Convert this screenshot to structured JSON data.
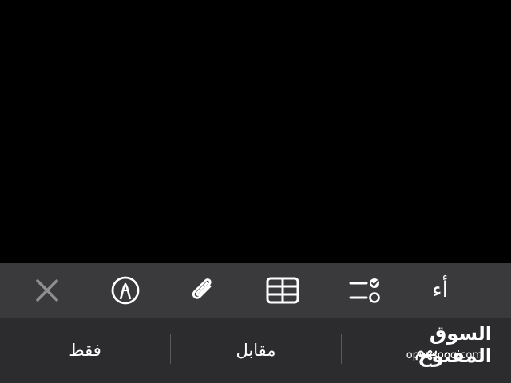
{
  "toolbar": {
    "items": [
      {
        "icon": "close-icon",
        "enabled": false
      },
      {
        "icon": "markup-pen-icon"
      },
      {
        "icon": "paperclip-icon"
      },
      {
        "icon": "table-icon"
      },
      {
        "icon": "checklist-icon"
      },
      {
        "icon": "text-format-icon",
        "label": "أء"
      }
    ]
  },
  "suggestions": [
    "فقط",
    "مقابل",
    "بهم"
  ],
  "watermark": {
    "arabic": "السوق المفتوح",
    "latin": "opensooq.com"
  },
  "colors": {
    "background": "#000000",
    "toolbar": "#3a3a3c",
    "suggestion_bar": "#2c2c2e",
    "icon": "#ffffff",
    "icon_disabled": "#8e8e93"
  }
}
